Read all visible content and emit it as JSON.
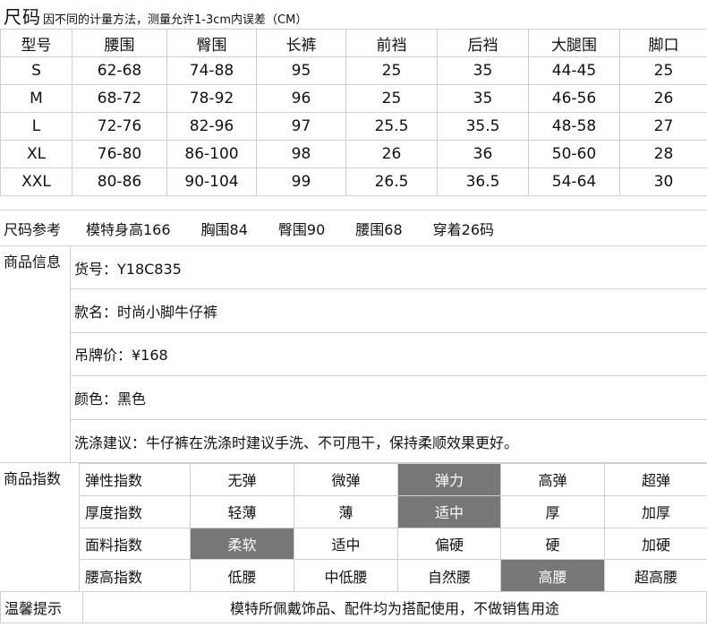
{
  "size_section": {
    "title": "尺码",
    "note": "因不同的计量方法，测量允许1-3cm内误差（CM）",
    "headers": [
      "型号",
      "腰围",
      "臀围",
      "长裤",
      "前裆",
      "后裆",
      "大腿围",
      "脚口"
    ],
    "rows": [
      [
        "S",
        "62-68",
        "74-88",
        "95",
        "25",
        "35",
        "44-45",
        "25"
      ],
      [
        "M",
        "68-72",
        "78-92",
        "96",
        "25",
        "35",
        "46-56",
        "26"
      ],
      [
        "L",
        "72-76",
        "82-96",
        "97",
        "25.5",
        "35.5",
        "48-58",
        "27"
      ],
      [
        "XL",
        "76-80",
        "86-100",
        "98",
        "26",
        "36",
        "50-60",
        "28"
      ],
      [
        "XXL",
        "80-86",
        "90-104",
        "99",
        "26.5",
        "36.5",
        "54-64",
        "30"
      ]
    ]
  },
  "size_reference": {
    "label": "尺码参考",
    "items": [
      "模特身高166",
      "胸围84",
      "臀围90",
      "腰围68",
      "穿着26码"
    ]
  },
  "product_info": {
    "label": "商品信息",
    "rows": [
      "货号：Y18C835",
      "款名：时尚小脚牛仔裤",
      "吊牌价：¥168",
      "颜色：黑色",
      "洗涤建议：牛仔裤在洗涤时建议手洗、不可甩干，保持柔顺效果更好。"
    ]
  },
  "product_index": {
    "label": "商品指数",
    "selected_color": "#777777",
    "rows": [
      {
        "name": "弹性指数",
        "options": [
          "无弹",
          "微弹",
          "弹力",
          "高弹",
          "超弹"
        ],
        "selected": 2
      },
      {
        "name": "厚度指数",
        "options": [
          "轻薄",
          "薄",
          "适中",
          "厚",
          "加厚"
        ],
        "selected": 2
      },
      {
        "name": "面料指数",
        "options": [
          "柔软",
          "适中",
          "偏硬",
          "硬",
          "加硬"
        ],
        "selected": 0
      },
      {
        "name": "腰高指数",
        "options": [
          "低腰",
          "中低腰",
          "自然腰",
          "高腰",
          "超高腰"
        ],
        "selected": 3
      }
    ]
  },
  "tip": {
    "label": "温馨提示",
    "text": "模特所佩戴饰品、配件均为搭配使用，不做销售用途"
  }
}
